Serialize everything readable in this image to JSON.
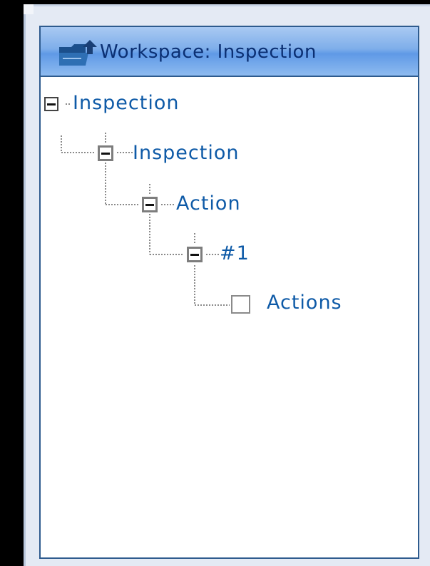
{
  "panel": {
    "title": "Workspace: Inspection",
    "icon": "folder-upload-icon"
  },
  "tree": {
    "root": {
      "label": "Inspection",
      "state": "expanded"
    },
    "child": {
      "label": "Inspection",
      "state": "expanded"
    },
    "grandchild": {
      "label": "Action",
      "state": "expanded"
    },
    "great_grandchild": {
      "label": "#1",
      "state": "expanded"
    },
    "leaf": {
      "label": "Actions",
      "checked": false
    }
  },
  "colors": {
    "background": "#000000",
    "header_gradient": "#7eaeea",
    "header_border": "#2e5b8e",
    "label_text": "#0e5aa7",
    "title_text": "#0b2f72"
  }
}
